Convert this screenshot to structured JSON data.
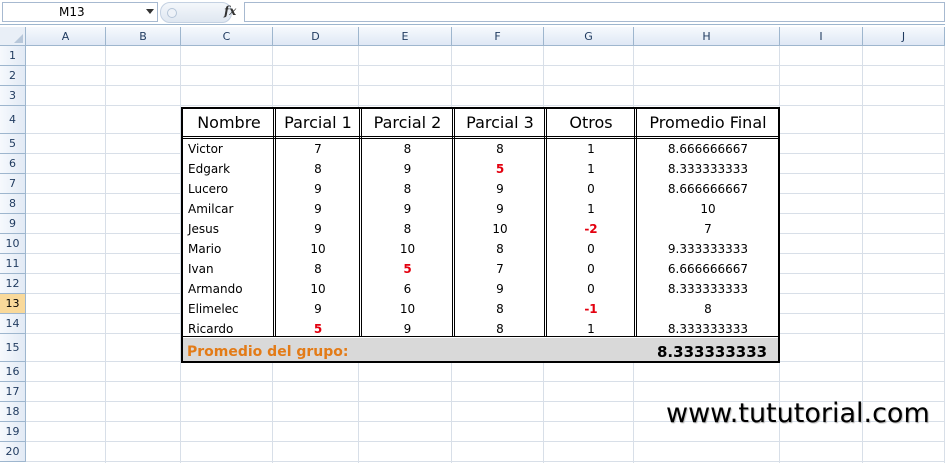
{
  "formula_bar": {
    "name_box": "M13",
    "fx_label": "fx",
    "formula": ""
  },
  "columns": [
    "A",
    "B",
    "C",
    "D",
    "E",
    "F",
    "G",
    "H",
    "I",
    "J"
  ],
  "rows": [
    "1",
    "2",
    "3",
    "4",
    "5",
    "6",
    "7",
    "8",
    "9",
    "10",
    "11",
    "12",
    "13",
    "14",
    "15",
    "16",
    "17",
    "18",
    "19",
    "20"
  ],
  "selected_row": "13",
  "table": {
    "headers": [
      "Nombre",
      "Parcial 1",
      "Parcial 2",
      "Parcial 3",
      "Otros",
      "Promedio Final"
    ],
    "rows": [
      [
        "Victor",
        "7",
        "8",
        "8",
        "1",
        "8.666666667"
      ],
      [
        "Edgark",
        "8",
        "9",
        "5",
        "1",
        "8.333333333"
      ],
      [
        "Lucero",
        "9",
        "8",
        "9",
        "0",
        "8.666666667"
      ],
      [
        "Amilcar",
        "9",
        "9",
        "9",
        "1",
        "10"
      ],
      [
        "Jesus",
        "9",
        "8",
        "10",
        "-2",
        "7"
      ],
      [
        "Mario",
        "10",
        "10",
        "8",
        "0",
        "9.333333333"
      ],
      [
        "Ivan",
        "8",
        "5",
        "7",
        "0",
        "6.666666667"
      ],
      [
        "Armando",
        "10",
        "6",
        "9",
        "0",
        "8.333333333"
      ],
      [
        "Elimelec",
        "9",
        "10",
        "8",
        "-1",
        "8"
      ],
      [
        "Ricardo",
        "5",
        "9",
        "8",
        "1",
        "8.333333333"
      ]
    ],
    "group_label": "Promedio del grupo:",
    "group_value": "8.333333333"
  },
  "highlight_color": "#e3000f",
  "label_color": "#e37b17",
  "watermark": "www.tututorial.com"
}
